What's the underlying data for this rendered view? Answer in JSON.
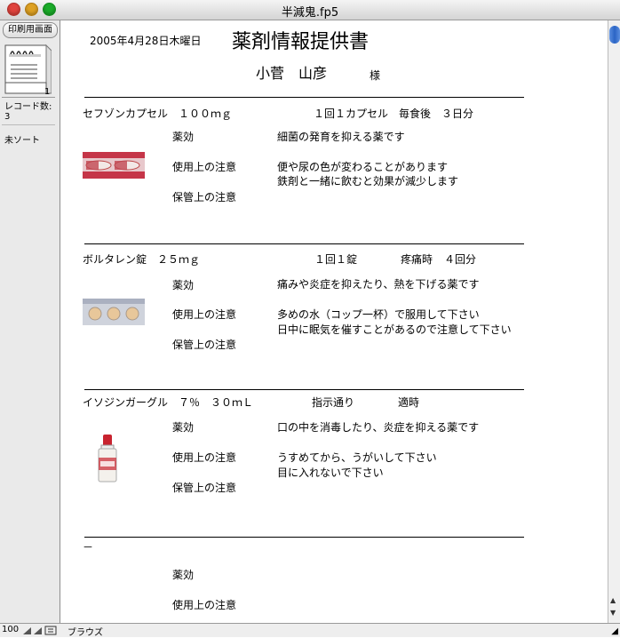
{
  "window": {
    "title": "半減鬼.fp5"
  },
  "sidebar": {
    "print_button": "印刷用画面",
    "record_number": "1",
    "record_count_label": "レコード数:",
    "record_count": "3",
    "sort_status": "未ソート"
  },
  "document": {
    "date": "2005年4月28日木曜日",
    "title": "薬剤情報提供書",
    "patient_name": "小菅　山彦",
    "honorific": "様",
    "drugs": [
      {
        "name": "セフゾンカプセル　１００ｍｇ",
        "dosage": "１回１カプセル　毎食後　３日分",
        "efficacy_label": "薬効",
        "efficacy": "細菌の発育を抑える薬です",
        "usage_label": "使用上の注意",
        "usage_1": "便や尿の色が変わることがあります",
        "usage_2": "鉄剤と一緒に飲むと効果が減少します",
        "storage_label": "保管上の注意",
        "image": "capsule-blister-pack"
      },
      {
        "name": "ボルタレン錠　２５ｍｇ",
        "dosage": "１回１錠",
        "timing": "疼痛時",
        "days": "４回分",
        "efficacy_label": "薬効",
        "efficacy": "痛みや炎症を抑えたり、熱を下げる薬です",
        "usage_label": "使用上の注意",
        "usage_1": "多めの水（コップ一杯）で服用して下さい",
        "usage_2": "日中に眠気を催すことがあるので注意して下さい",
        "storage_label": "保管上の注意",
        "image": "tablet-blister-pack"
      },
      {
        "name": "イソジンガーグル　７％　３０ｍＬ",
        "dosage": "指示通り",
        "timing": "適時",
        "efficacy_label": "薬効",
        "efficacy": "口の中を消毒したり、炎症を抑える薬です",
        "usage_label": "使用上の注意",
        "usage_1": "うすめてから、うがいして下さい",
        "usage_2": "目に入れないで下さい",
        "storage_label": "保管上の注意",
        "image": "gargle-bottle"
      },
      {
        "name": "－",
        "efficacy_label": "薬効",
        "usage_label": "使用上の注意"
      }
    ]
  },
  "bottombar": {
    "zoom": "100",
    "mode": "ブラウズ"
  },
  "colors": {
    "scroll_thumb": "#2b64c5",
    "close": "#e0443e",
    "minimize": "#dea123",
    "zoom": "#1aab29"
  }
}
